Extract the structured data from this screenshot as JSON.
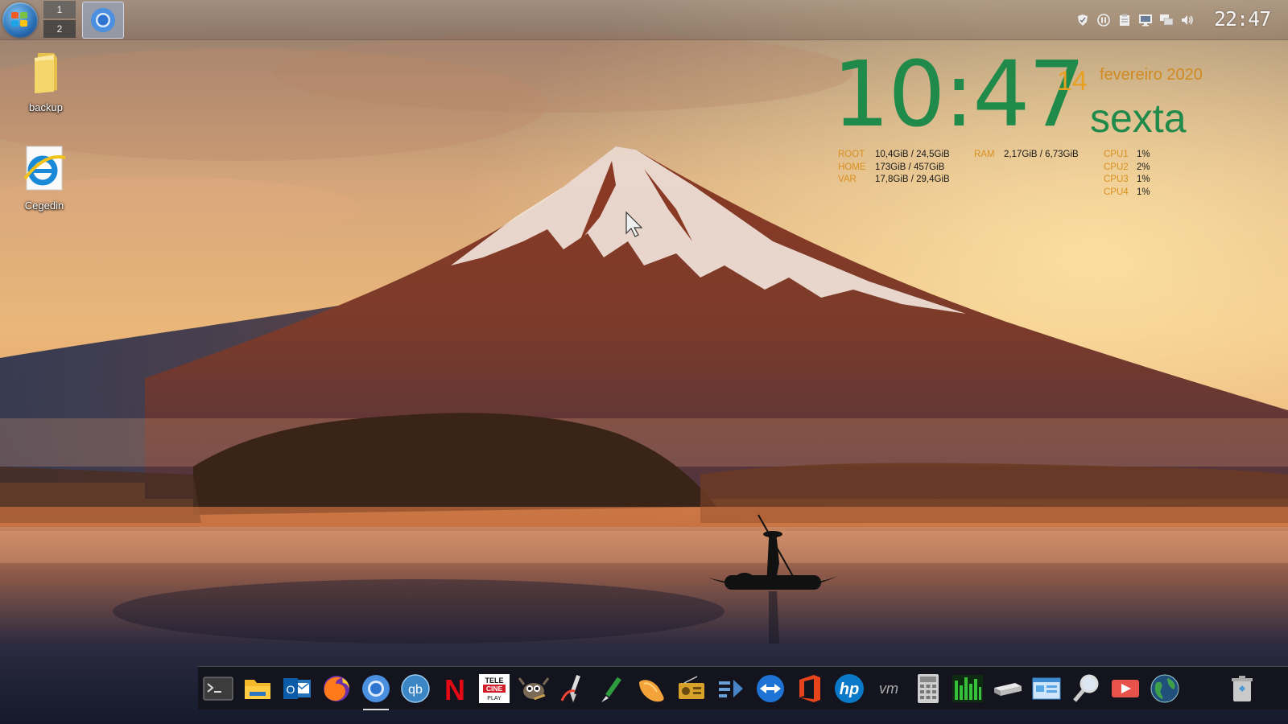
{
  "panel": {
    "pager": [
      "1",
      "2"
    ],
    "clock": "22:47",
    "task_icon": "chromium-icon",
    "tray_icons": [
      "shield-icon",
      "pause-icon",
      "clipboard-icon",
      "monitor-icon",
      "network-icon",
      "volume-icon"
    ]
  },
  "desktop": {
    "icons": [
      {
        "label": "backup",
        "icon": "folder-icon"
      },
      {
        "label": "Cegedin",
        "icon": "internet-explorer-icon"
      }
    ]
  },
  "conky": {
    "time": "10:47",
    "day": "14",
    "month_year": "fevereiro 2020",
    "weekday": "sexta",
    "disks": [
      {
        "key": "ROOT",
        "value": "10,4GiB / 24,5GiB"
      },
      {
        "key": "HOME",
        "value": "173GiB / 457GiB"
      },
      {
        "key": "VAR",
        "value": "17,8GiB / 29,4GiB"
      }
    ],
    "ram": {
      "key": "RAM",
      "value": "2,17GiB / 6,73GiB"
    },
    "cpus": [
      {
        "key": "CPU1",
        "value": "1%"
      },
      {
        "key": "CPU2",
        "value": "2%"
      },
      {
        "key": "CPU3",
        "value": "1%"
      },
      {
        "key": "CPU4",
        "value": "1%"
      }
    ],
    "colors": {
      "time": "#1f8a4a",
      "accent": "#d89020"
    }
  },
  "dock": {
    "items": [
      {
        "icon": "terminal-icon"
      },
      {
        "icon": "file-manager-icon"
      },
      {
        "icon": "outlook-icon",
        "label": "O"
      },
      {
        "icon": "firefox-icon"
      },
      {
        "icon": "chromium-icon",
        "active": true
      },
      {
        "icon": "qbittorrent-icon",
        "label": "qb"
      },
      {
        "icon": "netflix-icon",
        "label": "N"
      },
      {
        "icon": "telecine-icon",
        "label_top": "TELE",
        "label_mid": "CINE",
        "label_bot": "PLAY"
      },
      {
        "icon": "gimp-icon"
      },
      {
        "icon": "paint-icon"
      },
      {
        "icon": "color-picker-icon"
      },
      {
        "icon": "mango-icon"
      },
      {
        "icon": "radio-icon"
      },
      {
        "icon": "transfer-icon"
      },
      {
        "icon": "teamviewer-icon"
      },
      {
        "icon": "office-icon"
      },
      {
        "icon": "hp-icon",
        "label": "hp"
      },
      {
        "icon": "vmware-icon",
        "label": "vm"
      },
      {
        "icon": "calculator-icon"
      },
      {
        "icon": "system-monitor-icon"
      },
      {
        "icon": "scanner-icon"
      },
      {
        "icon": "control-panel-icon"
      },
      {
        "icon": "search-icon"
      },
      {
        "icon": "screen-recorder-icon"
      },
      {
        "icon": "globe-icon"
      }
    ],
    "trash": "trash-icon"
  }
}
